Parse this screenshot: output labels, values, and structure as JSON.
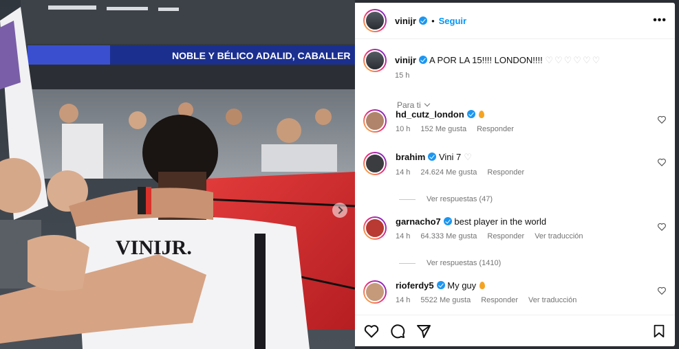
{
  "photo": {
    "banner_text": "NOBLE Y BÉLICO ADALID, CABALLER",
    "jersey_text": "VINIJR."
  },
  "header": {
    "username": "vinijr",
    "separator": "•",
    "follow_label": "Seguir",
    "more_label": "•••"
  },
  "caption": {
    "username": "vinijr",
    "text": "A POR LA 15!!!! LONDON!!!!",
    "hearts": "♡♡♡♡♡♡",
    "time": "15 h"
  },
  "sort_label": "Para ti",
  "comments": [
    {
      "username": "hd_cutz_london",
      "text": "",
      "time": "10 h",
      "likes": "152 Me gusta",
      "reply": "Responder",
      "translate": ""
    },
    {
      "username": "brahim",
      "text": "Vini 7",
      "time": "14 h",
      "likes": "24.624 Me gusta",
      "reply": "Responder",
      "translate": ""
    },
    {
      "username": "garnacho7",
      "text": "best player in the world",
      "time": "14 h",
      "likes": "64.333 Me gusta",
      "reply": "Responder",
      "translate": "Ver traducción"
    },
    {
      "username": "rioferdy5",
      "text": "My guy",
      "time": "14 h",
      "likes": "5522 Me gusta",
      "reply": "Responder",
      "translate": "Ver traducción"
    }
  ],
  "replies": [
    "Ver respuestas (47)",
    "Ver respuestas (1410)"
  ],
  "colors": {
    "accent": "#0095f6",
    "verified": "#1c96f0",
    "muted": "#737373"
  }
}
